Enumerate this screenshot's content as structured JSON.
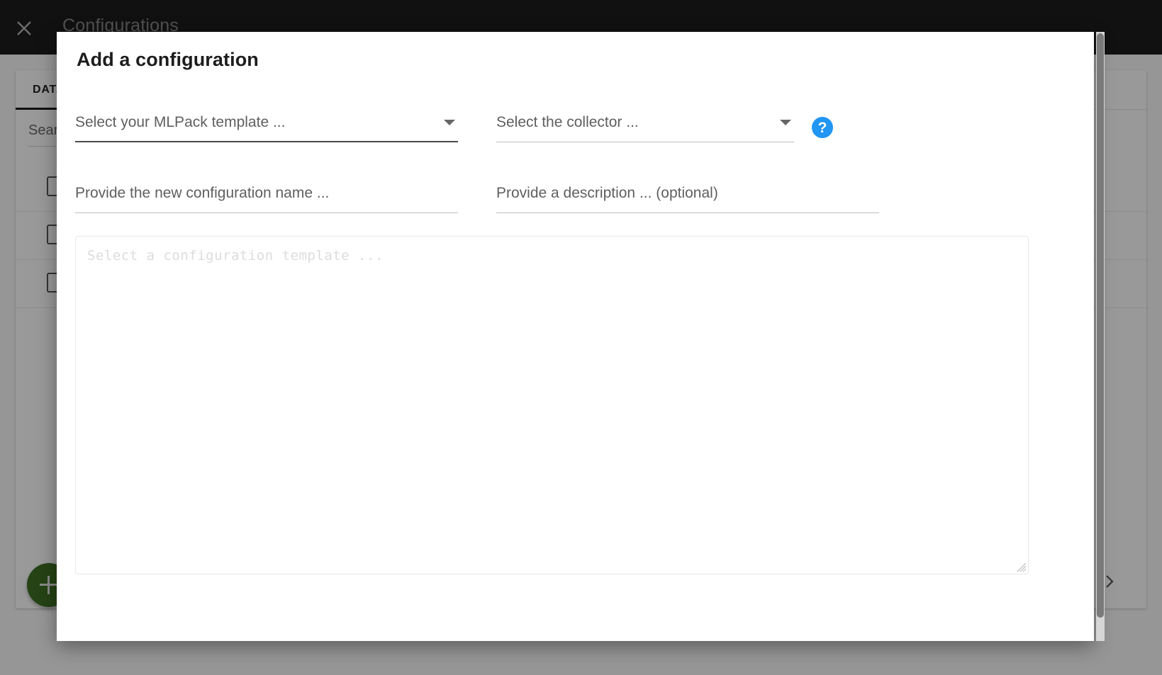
{
  "app": {
    "title": "Configurations",
    "close_icon": "close-icon",
    "tabs": [
      {
        "label": "DATA"
      }
    ],
    "search": {
      "placeholder": "Search"
    },
    "rows": [
      {
        "checkbox": "unchecked"
      },
      {
        "checkbox": "unchecked"
      },
      {
        "checkbox": "unchecked"
      }
    ],
    "pager": {
      "next_icon": "chevron-right-icon"
    },
    "fab": {
      "icon": "plus-icon",
      "color": "#4caf50"
    }
  },
  "modal": {
    "title": "Add a configuration",
    "fields": {
      "template_select": {
        "placeholder": "Select your MLPack template ...",
        "value": "",
        "caret_icon": "chevron-down-icon"
      },
      "collector_select": {
        "placeholder": "Select the collector ...",
        "value": "",
        "caret_icon": "chevron-down-icon"
      },
      "config_name": {
        "placeholder": "Provide the new configuration name ...",
        "value": ""
      },
      "description": {
        "placeholder": "Provide a description ... (optional)",
        "value": ""
      },
      "config_editor": {
        "placeholder": "Select a configuration template ...",
        "value": ""
      }
    },
    "help": {
      "icon": "help-icon",
      "label": "?",
      "color": "#2196f3"
    }
  },
  "colors": {
    "header_bg": "#222222",
    "accent_blue": "#2196f3",
    "fab_green": "#4caf50",
    "scrim": "rgba(0,0,0,0.40)"
  }
}
